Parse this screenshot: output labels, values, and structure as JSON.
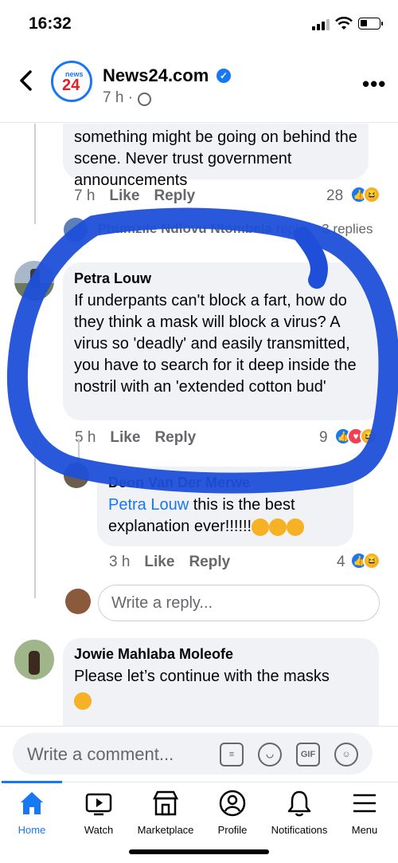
{
  "status_bar": {
    "time": "16:32"
  },
  "header": {
    "page_name": "News24.com",
    "logo_top": "news",
    "logo_bottom": "24",
    "meta": "7 h ·"
  },
  "comments": {
    "c1": {
      "text_partial": "something might be going on behind the scene. Never trust government announcements",
      "time": "7 h",
      "like_label": "Like",
      "reply_label": "Reply",
      "reaction_count": "28",
      "replies_author": "Phumzile Ndlovu Ntombela",
      "replies_suffix": "repl...",
      "replies_count": "· 3 replies"
    },
    "c2": {
      "author": "Petra Louw",
      "text": "If underpants can't block a fart, how do they think a mask will block a virus? A virus so 'deadly' and easily transmitted, you have to search for it deep inside the nostril with an 'extended cotton bud'",
      "time": "5 h",
      "like_label": "Like",
      "reply_label": "Reply",
      "reaction_count": "9",
      "reply": {
        "author": "Deon Van Der Merwe",
        "tag": "Petra Louw",
        "text": "this is the best explanation ever!!!!!!",
        "time": "3 h",
        "like_label": "Like",
        "reply_label": "Reply",
        "reaction_count": "4"
      },
      "write_reply_placeholder": "Write a reply..."
    },
    "c3": {
      "author": "Jowie Mahlaba Moleofe",
      "text": "Please let’s continue with the masks"
    }
  },
  "composer": {
    "placeholder": "Write a comment...",
    "gif_label": "GIF"
  },
  "tabs": [
    {
      "label": "Home",
      "icon": "home-icon",
      "active": true
    },
    {
      "label": "Watch",
      "icon": "watch-icon"
    },
    {
      "label": "Marketplace",
      "icon": "marketplace-icon"
    },
    {
      "label": "Profile",
      "icon": "profile-icon"
    },
    {
      "label": "Notifications",
      "icon": "bell-icon"
    },
    {
      "label": "Menu",
      "icon": "menu-icon"
    }
  ],
  "colors": {
    "accent": "#1877f2",
    "annotation": "#1f4fd8",
    "bubble": "#f0f2f5"
  }
}
